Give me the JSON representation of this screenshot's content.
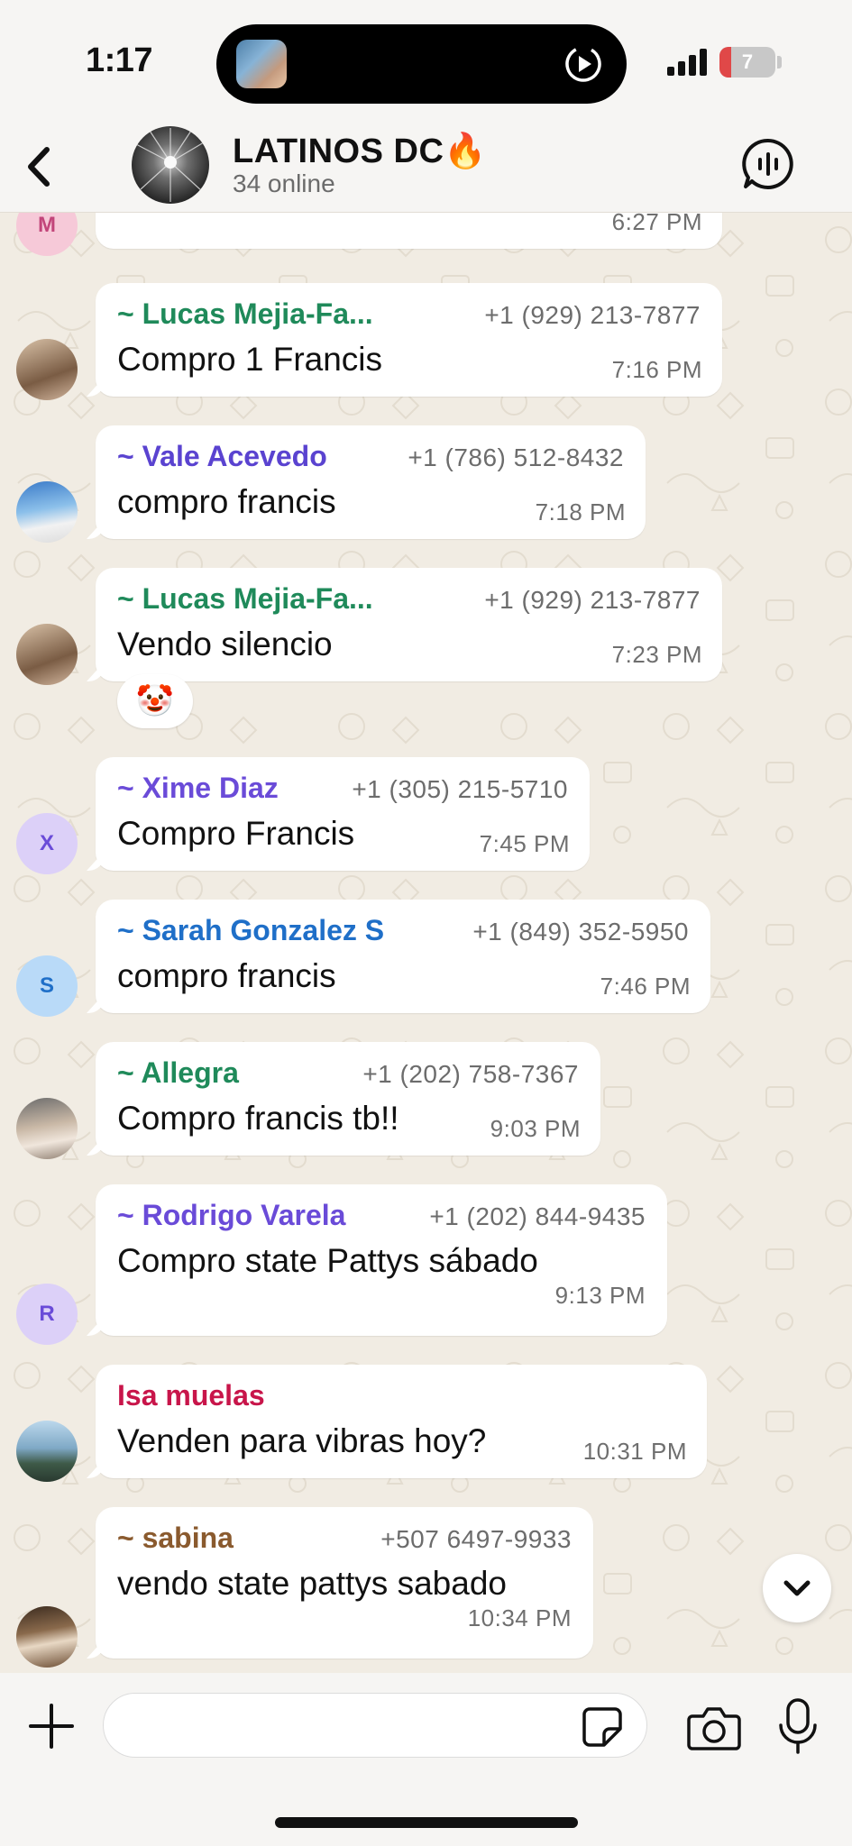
{
  "status_bar": {
    "time": "1:17",
    "battery_text": "7",
    "battery_level": 0.07,
    "battery_color": "#e04848"
  },
  "header": {
    "title": "LATINOS DC🔥",
    "subtitle": "34 online",
    "back_icon": "chevron-left-icon",
    "voice_icon": "voice-chat-icon"
  },
  "chat": {
    "partial_top": {
      "avatar_letter": "M",
      "time": "6:27 PM"
    },
    "messages": [
      {
        "sender": "~ Lucas Mejia-Fa...",
        "phone": "+1 (929) 213-7877",
        "text": "Compro 1 Francis",
        "time": "7:16 PM",
        "sender_color": "#1f8a5a"
      },
      {
        "sender": "~ Vale Acevedo",
        "phone": "+1 (786) 512-8432",
        "text": "compro francis",
        "time": "7:18 PM",
        "sender_color": "#5a43d0"
      },
      {
        "sender": "~ Lucas Mejia-Fa...",
        "phone": "+1 (929) 213-7877",
        "text": "Vendo silencio",
        "time": "7:23 PM",
        "sender_color": "#1f8a5a",
        "reaction": "🤡"
      },
      {
        "sender": "~ Xime Diaz",
        "phone": "+1 (305) 215-5710",
        "text": "Compro Francis",
        "time": "7:45 PM",
        "sender_color": "#6a4bd8",
        "avatar_letter": "X"
      },
      {
        "sender": "~ Sarah Gonzalez S",
        "phone": "+1 (849) 352-5950",
        "text": "compro francis",
        "time": "7:46 PM",
        "sender_color": "#1f6fc8",
        "avatar_letter": "S"
      },
      {
        "sender": "~ Allegra",
        "phone": "+1 (202) 758-7367",
        "text": "Compro francis tb!!",
        "time": "9:03 PM",
        "sender_color": "#1f8a5a"
      },
      {
        "sender": "~ Rodrigo Varela",
        "phone": "+1 (202) 844-9435",
        "text": "Compro state Pattys sábado",
        "time": "9:13 PM",
        "sender_color": "#6a4bd8",
        "avatar_letter": "R"
      },
      {
        "sender": "Isa muelas",
        "phone": "",
        "text": "Venden para vibras hoy?",
        "time": "10:31 PM",
        "sender_color": "#c8154a"
      },
      {
        "sender": "~ sabina",
        "phone": "+507 6497-9933",
        "text": "vendo state pattys sabado",
        "time": "10:34 PM",
        "sender_color": "#8a5a2e"
      }
    ]
  },
  "input": {
    "placeholder": "",
    "value": "",
    "plus_icon": "plus-icon",
    "sticker_icon": "sticker-icon",
    "camera_icon": "camera-icon",
    "mic_icon": "microphone-icon"
  },
  "colors": {
    "chat_background": "#f1ece3",
    "bubble": "#ffffff",
    "header_background": "#f6f5f3"
  }
}
